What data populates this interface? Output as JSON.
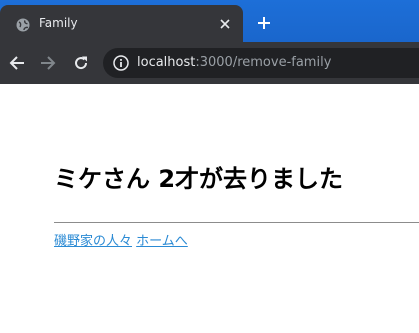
{
  "browser": {
    "tab": {
      "title": "Family",
      "favicon": "globe-icon",
      "close_icon": "close-icon"
    },
    "new_tab_icon": "plus-icon",
    "nav": {
      "back_icon": "back-arrow-icon",
      "forward_icon": "forward-arrow-icon",
      "reload_icon": "reload-icon"
    },
    "address": {
      "site_info_icon": "info-icon",
      "host": "localhost",
      "rest": ":3000/remove-family"
    },
    "colors": {
      "tabstrip": "#1a6fd6",
      "toolbar": "#35363a",
      "omnibox": "#202124"
    }
  },
  "page": {
    "heading": "ミケさん 2才が去りました",
    "links": [
      {
        "label": "磯野家の人々"
      },
      {
        "label": "ホームへ"
      }
    ],
    "link_color": "#2a8ad4"
  }
}
